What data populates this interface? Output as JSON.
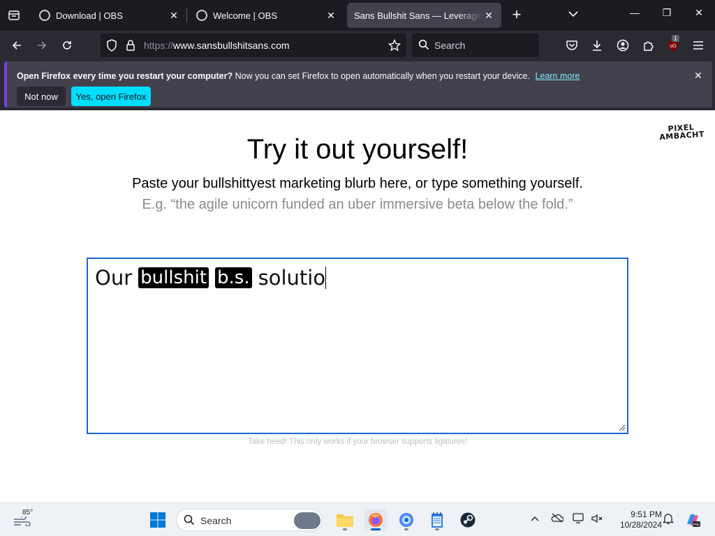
{
  "browser": {
    "tabs": [
      {
        "title": "Download | OBS",
        "active": false
      },
      {
        "title": "Welcome | OBS",
        "active": false
      },
      {
        "title": "Sans Bullshit Sans — Leveraging the",
        "active": true
      }
    ],
    "url_scheme": "https://",
    "url_host": "www.sansbullshitsans.com",
    "search_placeholder": "Search",
    "extension_badge": "1"
  },
  "notification": {
    "bold": "Open Firefox every time you restart your computer?",
    "message": "Now you can set Firefox to open automatically when you restart your device.",
    "learn_more": "Learn more",
    "not_now": "Not now",
    "yes": "Yes, open Firefox"
  },
  "page": {
    "brand_line1": "PIXEL",
    "brand_line2": "AMBACHT",
    "headline": "Try it out yourself!",
    "lead": "Paste your bullshittyest marketing blurb here, or type something yourself.",
    "example": "E.g. “the agile unicorn funded an uber immersive beta below the fold.”",
    "editor": {
      "word1": "Our",
      "block1": "bullshit",
      "block2": "b.s.",
      "word2": "solutio"
    },
    "footnote": "Take heed! This only works if your browser supports ligatures!"
  },
  "taskbar": {
    "weather_temp": "85°",
    "search_placeholder": "Search",
    "time": "9:51 PM",
    "date": "10/28/2024"
  },
  "colors": {
    "accent": "#1a66d4",
    "notif_primary": "#00ddff",
    "chrome_dark": "#1c1b22"
  }
}
